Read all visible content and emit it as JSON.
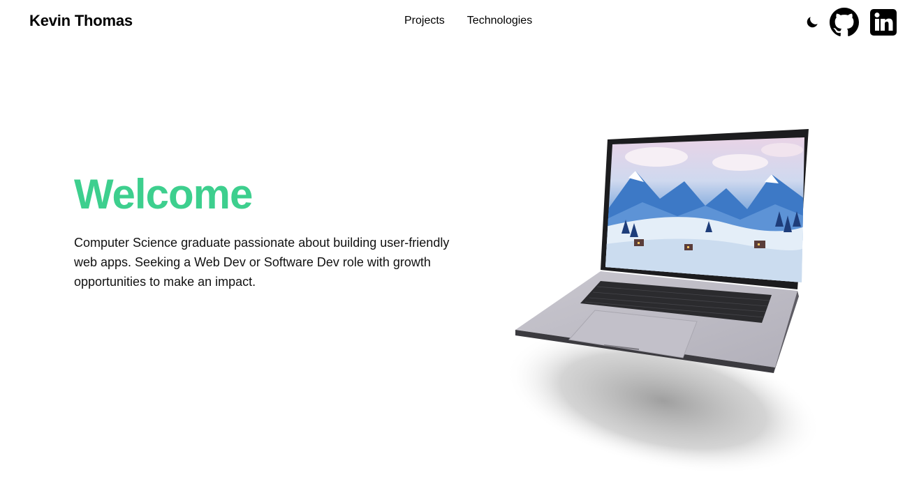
{
  "header": {
    "brand": "Kevin Thomas",
    "nav": [
      "Projects",
      "Technologies"
    ],
    "icons": [
      "moon-icon",
      "github-icon",
      "linkedin-icon"
    ]
  },
  "hero": {
    "title": "Welcome",
    "description": "Computer Science graduate passionate about building user-friendly web apps. Seeking a Web Dev or Software Dev role with growth opportunities to make an impact."
  },
  "colors": {
    "accent": "#3dcf8e",
    "text": "#000000",
    "background": "#ffffff"
  }
}
